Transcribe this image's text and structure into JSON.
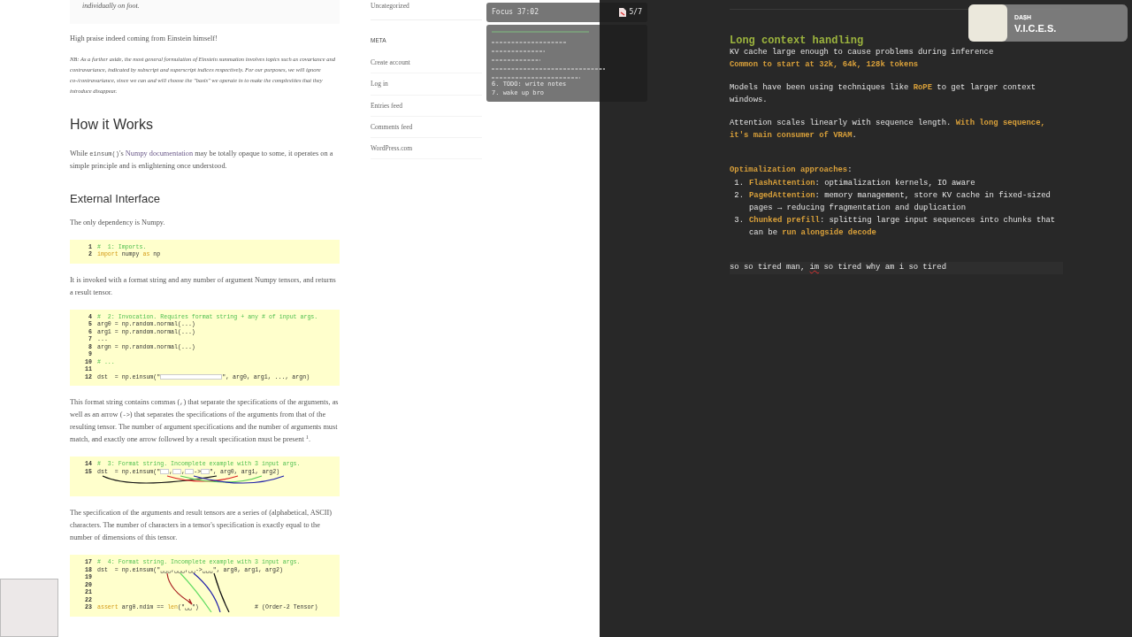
{
  "article": {
    "quote_tail": "individually on foot.",
    "blocks": [
      {
        "kind": "para",
        "parts": [
          {
            "t": "High praise indeed coming from Einstein himself!"
          }
        ]
      },
      {
        "kind": "note",
        "parts": [
          {
            "t": "NB: As a further aside, the most general formulation of Einstein summation involves topics such as covariance and contravariance, indicated by subscript and superscript indices respectively. For our purposes, we will ignore co-/contravariance, since we can and will choose the \"basis\" we operate in to make the complexities that they introduce disappear."
          }
        ]
      },
      {
        "kind": "h2",
        "parts": [
          {
            "t": "How it Works"
          }
        ]
      },
      {
        "kind": "para",
        "parts": [
          {
            "t": "While "
          },
          {
            "t": "einsum()",
            "kind": "code"
          },
          {
            "t": "'s "
          },
          {
            "t": "Numpy documentation",
            "kind": "link"
          },
          {
            "t": " may be totally opaque to some, it operates on a simple principle and is enlightening once understood."
          }
        ]
      },
      {
        "kind": "h3",
        "parts": [
          {
            "t": "External Interface"
          }
        ]
      },
      {
        "kind": "para",
        "parts": [
          {
            "t": "The only dependency is Numpy."
          }
        ]
      },
      {
        "kind": "code",
        "annotated": false,
        "lines": [
          {
            "no": "1",
            "parts": [
              {
                "t": "#  1: Imports.",
                "kind": "comment"
              }
            ]
          },
          {
            "no": "2",
            "parts": [
              {
                "t": "import",
                "kind": "keyword"
              },
              {
                "t": " numpy "
              },
              {
                "t": "as",
                "kind": "keyword"
              },
              {
                "t": " np"
              }
            ]
          }
        ]
      },
      {
        "kind": "para",
        "parts": [
          {
            "t": "It is invoked with a format string and any number of argument Numpy tensors, and returns a result tensor."
          }
        ]
      },
      {
        "kind": "code",
        "annotated": false,
        "lines": [
          {
            "no": "4",
            "parts": [
              {
                "t": "#  2: Invocation. Requires format string + any # of input args.",
                "kind": "comment"
              }
            ]
          },
          {
            "no": "5",
            "parts": [
              {
                "t": "arg0 = np.random.normal(...)"
              }
            ]
          },
          {
            "no": "6",
            "parts": [
              {
                "t": "arg1 = np.random.normal(...)"
              }
            ]
          },
          {
            "no": "7",
            "parts": [
              {
                "t": "..."
              }
            ]
          },
          {
            "no": "8",
            "parts": [
              {
                "t": "argn = np.random.normal(...)"
              }
            ]
          },
          {
            "no": "9"
          },
          {
            "no": "10",
            "parts": [
              {
                "t": "# ...",
                "kind": "comment"
              }
            ]
          },
          {
            "no": "11"
          },
          {
            "no": "12",
            "parts": [
              {
                "t": "dst  = np.einsum(\""
              },
              {
                "kind": "blank"
              },
              {
                "t": "\", arg0, arg1, ..., argn)"
              }
            ]
          }
        ]
      },
      {
        "kind": "para",
        "parts": [
          {
            "t": "This format string contains commas ("
          },
          {
            "t": ",",
            "kind": "code"
          },
          {
            "t": ") that separate the specifications of the arguments, as well as an arrow ("
          },
          {
            "t": "->",
            "kind": "code"
          },
          {
            "t": ") that separates the specifications of the arguments from that of the resulting tensor. The number of argument specifications and the number of arguments must match, and exactly one arrow followed by a result specification must be present $^{1}$."
          }
        ]
      },
      {
        "kind": "code",
        "annotated": true,
        "lines": [
          {
            "no": "14",
            "parts": [
              {
                "t": "#  3: Format string. Incomplete example with 3 input args.",
                "kind": "comment"
              }
            ]
          },
          {
            "no": "15",
            "parts": [
              {
                "t": "dst  = np.einsum(\""
              },
              {
                "kind": "short"
              },
              {
                "t": ","
              },
              {
                "kind": "short"
              },
              {
                "t": ","
              },
              {
                "kind": "short"
              },
              {
                "t": "->"
              },
              {
                "kind": "short"
              },
              {
                "t": "\", arg0, arg1, arg2)"
              }
            ]
          }
        ]
      },
      {
        "kind": "para",
        "parts": [
          {
            "t": "The specification of the arguments and result tensors are a series of (alphabetical, ASCII) characters. The number of characters in a tensor's specification is exactly equal to the number of dimensions of this tensor."
          }
        ]
      },
      {
        "kind": "code",
        "annotated": true,
        "lines": [
          {
            "no": "17",
            "parts": [
              {
                "t": "#  4: Format string. Incomplete example with 3 input args.",
                "kind": "comment"
              }
            ]
          },
          {
            "no": "18",
            "parts": [
              {
                "t": "dst  = np.einsum(\"␣␣␣,␣␣␣,␣␣->␣␣␣\", arg0, arg1, arg2)"
              }
            ]
          },
          {
            "no": "19"
          },
          {
            "no": "20"
          },
          {
            "no": "21"
          },
          {
            "no": "22"
          },
          {
            "no": "23",
            "parts": [
              {
                "t": "assert",
                "kind": "keyword"
              },
              {
                "t": " arg0.ndim == "
              },
              {
                "t": "len",
                "kind": "keyword"
              },
              {
                "t": "(\"␣␣\")                # (Order-2 Tensor)"
              }
            ]
          }
        ]
      }
    ]
  },
  "sidebar": {
    "top_link": "Uncategorized",
    "heading": "META",
    "links": [
      "Create account",
      "Log in",
      "Entries feed",
      "Comments feed",
      "WordPress.com"
    ]
  },
  "focus": {
    "title": "Focus 37:02",
    "count": "5/7",
    "items": [
      "6. TODO: write notes",
      "7. wake up bro"
    ]
  },
  "now_playing": {
    "artist": "DA$H",
    "title": "V.I.C.E.S."
  },
  "notes": {
    "heading": "Long context handling",
    "paragraphs": [
      [
        [
          {
            "t": "KV cache large enough to cause problems during inference",
            "accent": false
          }
        ],
        [
          {
            "t": "Common to start at 32k, 64k, 128k tokens",
            "accent": true
          }
        ]
      ],
      [
        [
          {
            "t": "Models have been using techniques like ",
            "accent": false
          },
          {
            "t": "RoPE",
            "accent": true
          },
          {
            "t": " to get larger context",
            "accent": false
          }
        ],
        [
          {
            "t": "windows.",
            "accent": false
          }
        ]
      ],
      [
        [
          {
            "t": "Attention scales linearly with sequence length. ",
            "accent": false
          },
          {
            "t": "With long sequence,",
            "accent": true
          }
        ],
        [
          {
            "t": "it's main consumer of VRAM",
            "accent": true
          },
          {
            "t": ".",
            "accent": false
          }
        ]
      ]
    ],
    "list_title": [
      {
        "t": "Optimalization approaches",
        "accent": true
      },
      {
        "t": ":",
        "accent": false
      }
    ],
    "items": [
      {
        "no": "1.",
        "lines": [
          [
            {
              "t": "FlashAttention",
              "accent": true
            },
            {
              "t": ": optimalization kernels, IO aware",
              "accent": false
            }
          ]
        ]
      },
      {
        "no": "2.",
        "lines": [
          [
            {
              "t": "PagedAttention",
              "accent": true
            },
            {
              "t": ": memory management, store KV cache in fixed-sized",
              "accent": false
            }
          ],
          [
            {
              "t": "pages → reducing fragmentation and duplication",
              "accent": false
            }
          ]
        ]
      },
      {
        "no": "3.",
        "lines": [
          [
            {
              "t": "Chunked prefill",
              "accent": true
            },
            {
              "t": ": splitting large input sequences into chunks that",
              "accent": false
            }
          ],
          [
            {
              "t": "can be ",
              "accent": false
            },
            {
              "t": "run alongside decode",
              "accent": true
            }
          ]
        ]
      }
    ],
    "draft": [
      {
        "t": "so so tired man, ",
        "misspelled": false
      },
      {
        "t": "im",
        "misspelled": true
      },
      {
        "t": " so tired why am i so tired",
        "misspelled": false
      }
    ]
  }
}
